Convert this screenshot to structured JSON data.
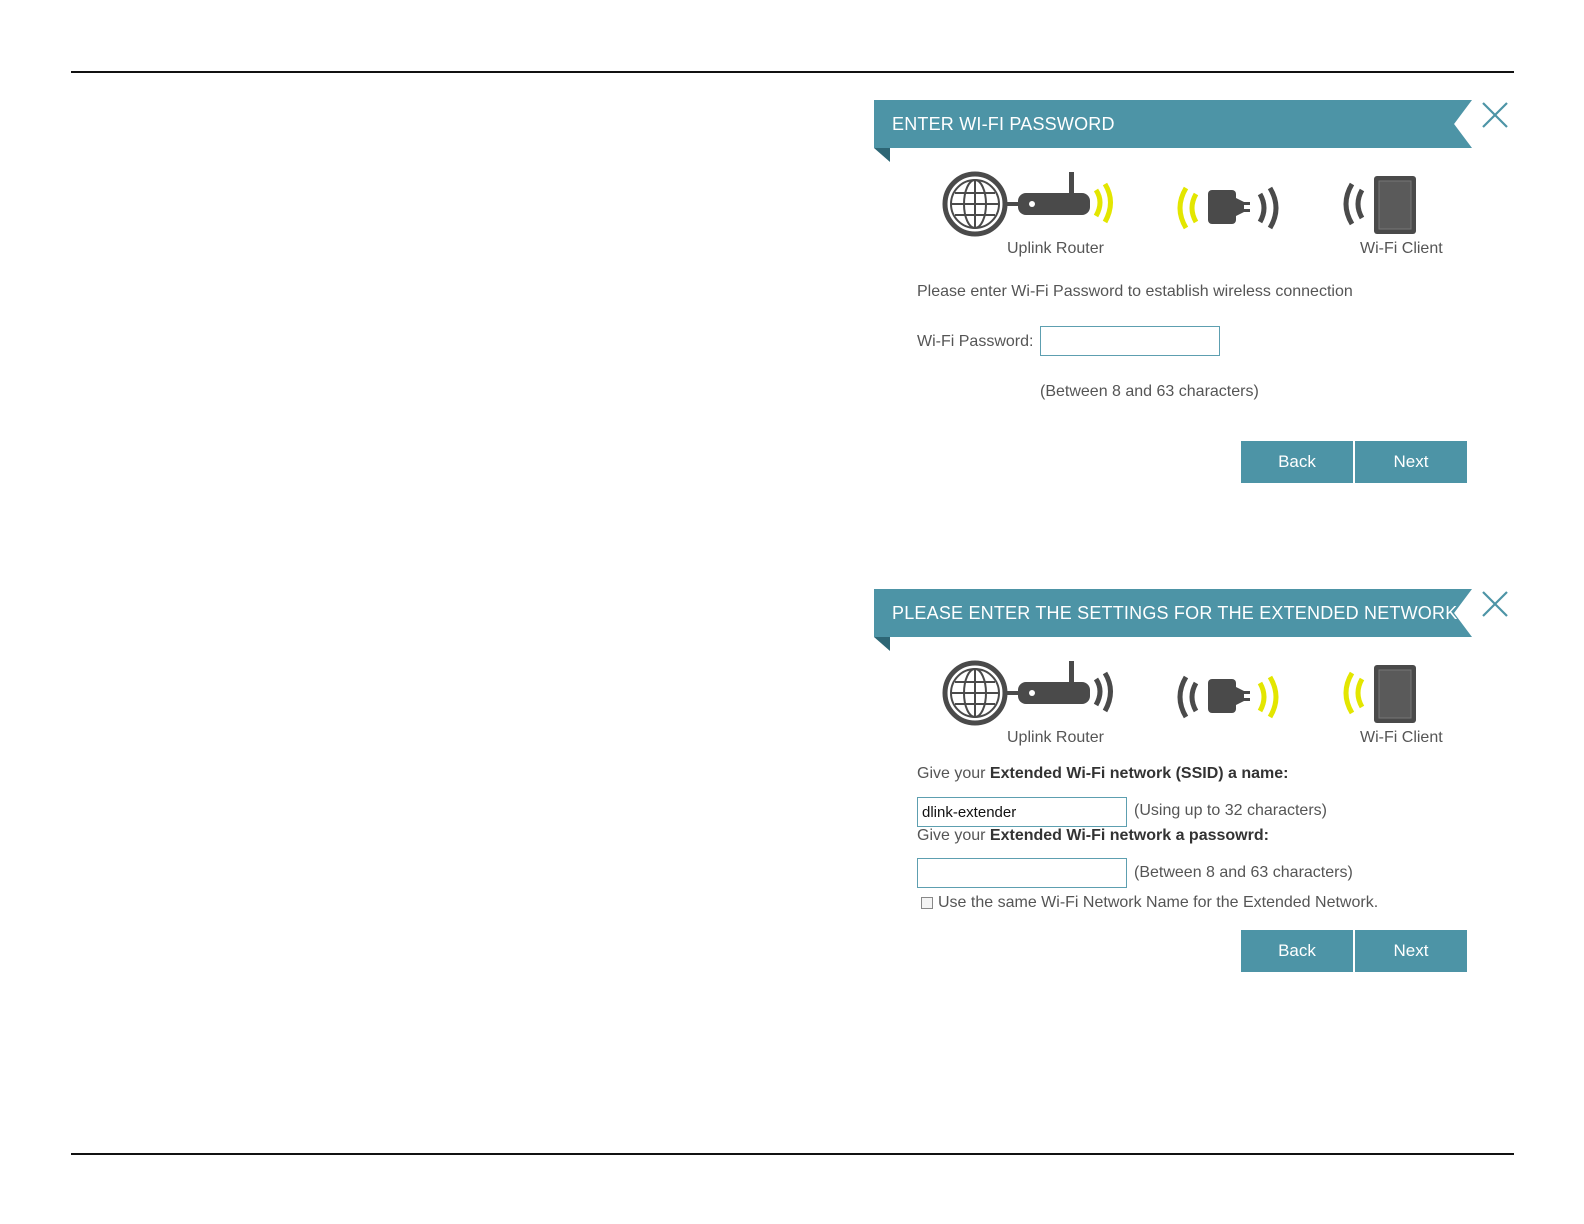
{
  "panel1": {
    "title": "ENTER WI-FI PASSWORD",
    "icons": {
      "router_label": "Uplink Router",
      "client_label": "Wi-Fi Client",
      "highlight_color": "#e3e600"
    },
    "instruction": "Please enter Wi-Fi Password to establish wireless connection",
    "password_label": "Wi-Fi Password:",
    "password_value": "",
    "hint": "(Between 8 and 63 characters)",
    "back_label": "Back",
    "next_label": "Next"
  },
  "panel2": {
    "title": "PLEASE ENTER THE SETTINGS FOR THE EXTENDED NETWORK",
    "icons": {
      "router_label": "Uplink Router",
      "client_label": "Wi-Fi Client",
      "highlight_color": "#e3e600"
    },
    "ssid_prompt_pre": "Give your ",
    "ssid_prompt_bold": "Extended Wi-Fi network (SSID) a name:",
    "ssid_value": "dlink-extender",
    "ssid_hint": "(Using up to 32 characters)",
    "pw_prompt_pre": "Give your ",
    "pw_prompt_bold": "Extended Wi-Fi network a passowrd:",
    "pw_value": "",
    "pw_hint": "(Between 8 and 63 characters)",
    "checkbox_label": "Use the same Wi-Fi Network Name for the Extended Network.",
    "checkbox_checked": false,
    "back_label": "Back",
    "next_label": "Next"
  },
  "colors": {
    "accent": "#4d94a6",
    "accent_dark": "#2d6675",
    "icon_gray": "#4a4a4a",
    "signal_yellow": "#e3e600"
  }
}
